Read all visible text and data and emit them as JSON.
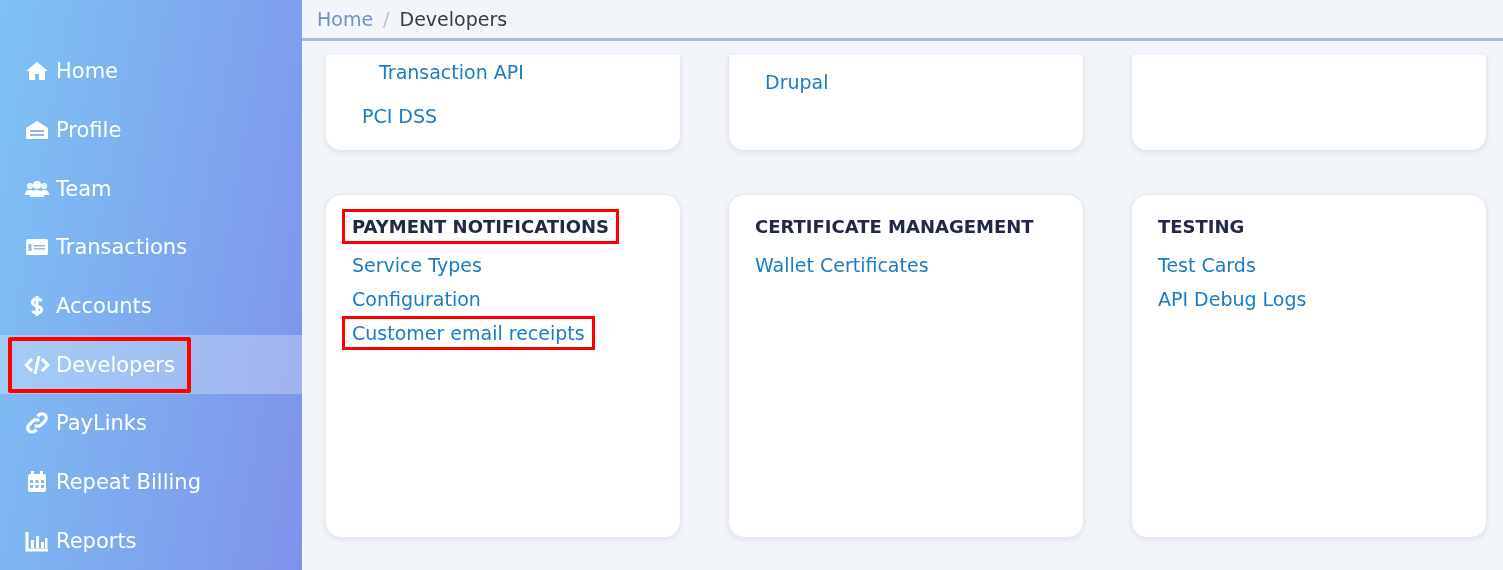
{
  "sidebar": {
    "items": [
      {
        "label": "Home",
        "selected": false,
        "highlighted": false
      },
      {
        "label": "Profile",
        "selected": false,
        "highlighted": false
      },
      {
        "label": "Team",
        "selected": false,
        "highlighted": false
      },
      {
        "label": "Transactions",
        "selected": false,
        "highlighted": false
      },
      {
        "label": "Accounts",
        "selected": false,
        "highlighted": false
      },
      {
        "label": "Developers",
        "selected": true,
        "highlighted": true
      },
      {
        "label": "PayLinks",
        "selected": false,
        "highlighted": false
      },
      {
        "label": "Repeat Billing",
        "selected": false,
        "highlighted": false
      },
      {
        "label": "Reports",
        "selected": false,
        "highlighted": false
      }
    ]
  },
  "breadcrumb": [
    {
      "label": "Home",
      "kind": "link"
    },
    {
      "label": "/",
      "kind": "separator"
    },
    {
      "label": "Developers",
      "kind": "current"
    }
  ],
  "top_cards": [
    {
      "links": [
        {
          "label": "Transaction API",
          "kind": "sub"
        },
        {
          "label": "PCI DSS",
          "kind": "link"
        }
      ]
    },
    {
      "links": [
        {
          "label": "Drupal",
          "kind": "link"
        }
      ]
    }
  ],
  "cards": [
    {
      "title": "PAYMENT NOTIFICATIONS",
      "highlighted": true,
      "links": [
        {
          "label": "Service Types",
          "highlighted": false
        },
        {
          "label": "Configuration",
          "highlighted": false
        },
        {
          "label": "Customer email receipts",
          "highlighted": true
        }
      ]
    },
    {
      "title": "CERTIFICATE MANAGEMENT",
      "highlighted": false,
      "links": [
        {
          "label": "Wallet Certificates",
          "highlighted": false
        }
      ]
    },
    {
      "title": "TESTING",
      "highlighted": false,
      "links": [
        {
          "label": "Test Cards",
          "highlighted": false
        },
        {
          "label": "API Debug Logs",
          "highlighted": false
        }
      ]
    }
  ]
}
